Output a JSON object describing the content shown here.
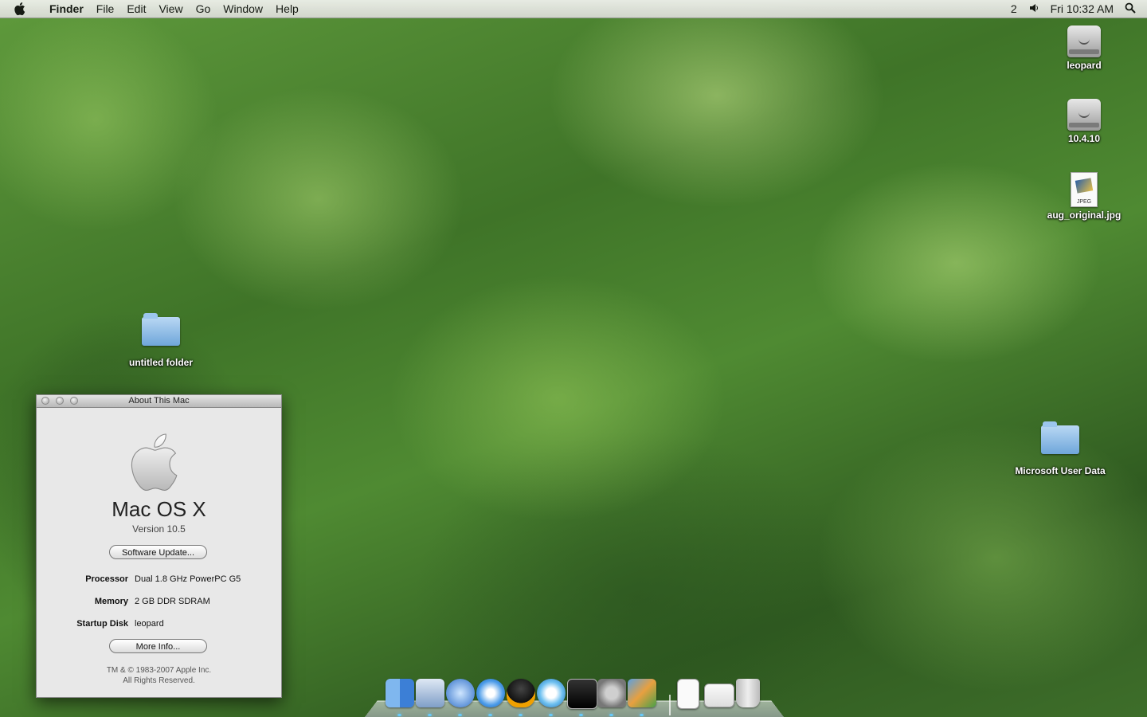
{
  "menubar": {
    "items": [
      "Finder",
      "File",
      "Edit",
      "View",
      "Go",
      "Window",
      "Help"
    ],
    "status_number": "2",
    "clock": "Fri 10:32 AM"
  },
  "desktop": {
    "icons": [
      {
        "label": "leopard",
        "kind": "hard-drive-icon"
      },
      {
        "label": "10.4.10",
        "kind": "hard-drive-icon"
      },
      {
        "label": "aug_original.jpg",
        "kind": "jpeg-file-icon",
        "badge": "JPEG"
      },
      {
        "label": "untitled folder",
        "kind": "folder-icon"
      },
      {
        "label": "Microsoft User Data",
        "kind": "folder-icon"
      }
    ]
  },
  "about_window": {
    "title": "About This Mac",
    "os_name": "Mac OS X",
    "version": "Version 10.5",
    "software_update_label": "Software Update...",
    "specs": [
      {
        "key": "Processor",
        "value": "Dual 1.8 GHz PowerPC G5"
      },
      {
        "key": "Memory",
        "value": "2 GB DDR SDRAM"
      },
      {
        "key": "Startup Disk",
        "value": "leopard"
      }
    ],
    "more_info_label": "More Info...",
    "copyright_line1": "TM & © 1983-2007 Apple Inc.",
    "copyright_line2": "All Rights Reserved."
  },
  "dock": {
    "apps": [
      "finder-icon",
      "mail-icon",
      "dashboard-icon",
      "safari-icon",
      "adium-icon",
      "itunes-icon",
      "terminal-icon",
      "system-preferences-icon",
      "iphoto-icon",
      "textedit-document-icon",
      "preview-document-icon",
      "trash-icon"
    ]
  },
  "colors": {
    "desktop_green": "#4f8a32",
    "folder_blue": "#6fa6da",
    "window_bg": "#e8e8e8"
  }
}
